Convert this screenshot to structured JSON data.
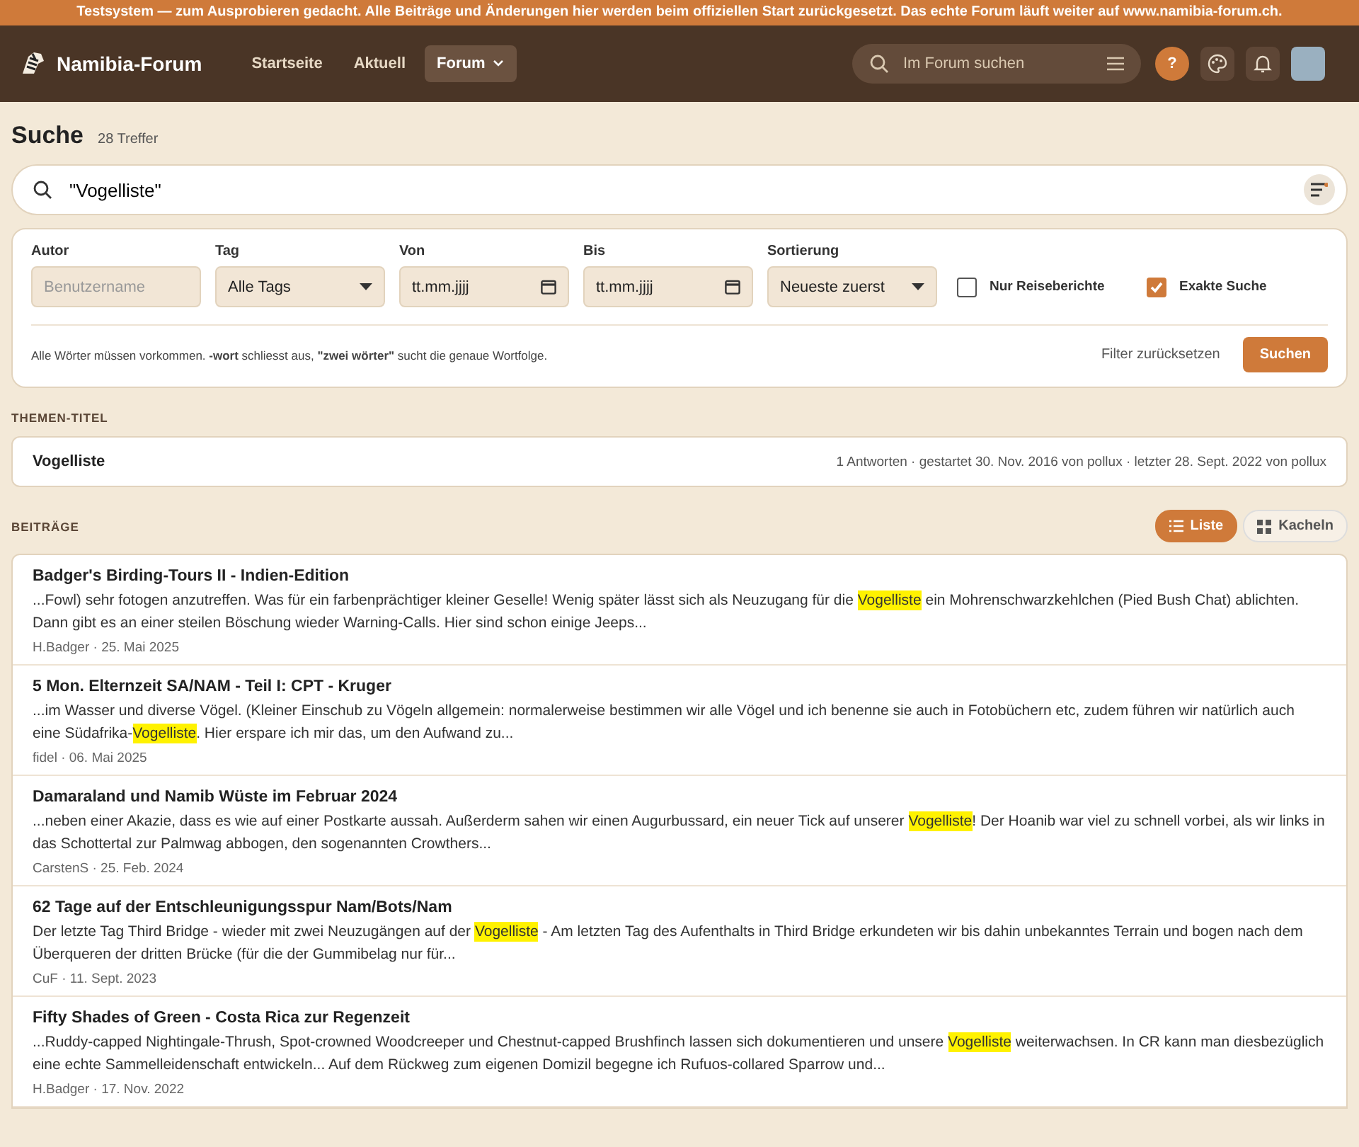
{
  "banner": "Testsystem — zum Ausprobieren gedacht. Alle Beiträge und Änderungen hier werden beim offiziellen Start zurückgesetzt. Das echte Forum läuft weiter auf www.namibia-forum.ch.",
  "header": {
    "logo": "Namibia-Forum",
    "nav": [
      {
        "label": "Startseite",
        "selected": false,
        "dropdown": false
      },
      {
        "label": "Aktuell",
        "selected": false,
        "dropdown": false
      },
      {
        "label": "Forum",
        "selected": true,
        "dropdown": true
      }
    ],
    "search": {
      "placeholder": "Im Forum suchen"
    },
    "help": "?"
  },
  "page": {
    "title": "Suche",
    "count": "28 Treffer"
  },
  "query": {
    "value": "\"Vogelliste\""
  },
  "filters": {
    "fields": [
      {
        "kind": "text",
        "label": "Autor",
        "placeholder": "Benutzername"
      },
      {
        "kind": "select",
        "label": "Tag",
        "value": "Alle Tags"
      },
      {
        "kind": "date",
        "label": "Von",
        "value": "tt.mm.jjjj"
      },
      {
        "kind": "date",
        "label": "Bis",
        "value": "tt.mm.jjjj"
      },
      {
        "kind": "select",
        "label": "Sortierung",
        "value": "Neueste zuerst"
      }
    ],
    "checkboxes": [
      {
        "label": "Nur Reiseberichte",
        "checked": false
      },
      {
        "label": "Exakte Suche",
        "checked": true
      }
    ],
    "hint": "Alle Wörter müssen vorkommen. **-wort** schliesst aus, **\"zwei wörter\"** sucht die genaue Wortfolge.",
    "reset": "Filter zurücksetzen",
    "submit": "Suchen"
  },
  "topics": {
    "heading": "THEMEN-TITEL",
    "items": [
      {
        "title": "Vogelliste",
        "meta": "1 Antworten · gestartet 30. Nov. 2016 von pollux · letzter 28. Sept. 2022 von pollux"
      }
    ]
  },
  "posts": {
    "heading": "BEITRÄGE",
    "views": [
      {
        "label": "Liste",
        "kind": "list",
        "selected": true
      },
      {
        "label": "Kacheln",
        "kind": "tiles",
        "selected": false
      }
    ],
    "items": [
      {
        "title": "Badger's Birding-Tours II - Indien-Edition",
        "excerpt": [
          {
            "text": "...Fowl) sehr fotogen anzutreffen. Was für ein farbenprächtiger kleiner Geselle! Wenig später lässt sich als Neuzugang für die ",
            "highlighted": false
          },
          {
            "text": "Vogelliste",
            "highlighted": true
          },
          {
            "text": " ein Mohrenschwarzkehlchen (Pied Bush Chat) ablichten. Dann gibt es an einer steilen Böschung wieder Warning-Calls. Hier sind schon einige Jeeps...",
            "highlighted": false
          }
        ],
        "meta": "H.Badger · 25. Mai 2025"
      },
      {
        "title": "5 Mon. Elternzeit SA/NAM - Teil I: CPT - Kruger",
        "excerpt": [
          {
            "text": "...im Wasser und diverse Vögel. (Kleiner Einschub zu Vögeln allgemein: normalerweise bestimmen wir alle Vögel und ich benenne sie auch in Fotobüchern etc, zudem führen wir natürlich auch eine Südafrika-",
            "highlighted": false
          },
          {
            "text": "Vogelliste",
            "highlighted": true
          },
          {
            "text": ". Hier erspare ich mir das, um den Aufwand zu...",
            "highlighted": false
          }
        ],
        "meta": "fidel · 06. Mai 2025"
      },
      {
        "title": "Damaraland und Namib Wüste im Februar 2024",
        "excerpt": [
          {
            "text": "...neben einer Akazie, dass es wie auf einer Postkarte aussah. Außerderm sahen wir einen Augurbussard, ein neuer Tick auf unserer ",
            "highlighted": false
          },
          {
            "text": "Vogelliste",
            "highlighted": true
          },
          {
            "text": "! Der Hoanib war viel zu schnell vorbei, als wir links in das Schottertal zur Palmwag abbogen, den sogenannten Crowthers...",
            "highlighted": false
          }
        ],
        "meta": "CarstenS · 25. Feb. 2024"
      },
      {
        "title": "62 Tage auf der Entschleunigungsspur Nam/Bots/Nam",
        "excerpt": [
          {
            "text": "Der letzte Tag Third Bridge - wieder mit zwei Neuzugängen auf der ",
            "highlighted": false
          },
          {
            "text": "Vogelliste",
            "highlighted": true
          },
          {
            "text": " - Am letzten Tag des Aufenthalts in Third Bridge erkundeten wir bis dahin unbekanntes Terrain und bogen nach dem Überqueren der dritten Brücke (für die der Gummibelag nur für...",
            "highlighted": false
          }
        ],
        "meta": "CuF · 11. Sept. 2023"
      },
      {
        "title": "Fifty Shades of Green - Costa Rica zur Regenzeit",
        "excerpt": [
          {
            "text": "...Ruddy-capped Nightingale-Thrush, Spot-crowned Woodcreeper und Chestnut-capped Brushfinch lassen sich dokumentieren und unsere ",
            "highlighted": false
          },
          {
            "text": "Vogelliste",
            "highlighted": true
          },
          {
            "text": " weiterwachsen. In CR kann man diesbezüglich eine echte Sammelleidenschaft entwickeln... Auf dem Rückweg zum eigenen Domizil begegne ich Rufuos-collared Sparrow und...",
            "highlighted": false
          }
        ],
        "meta": "H.Badger · 17. Nov. 2022"
      }
    ]
  }
}
